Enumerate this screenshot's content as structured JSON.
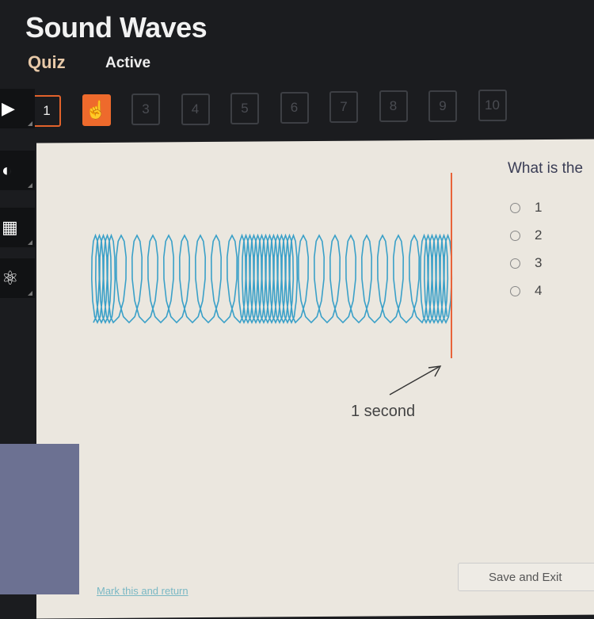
{
  "header": {
    "title": "Sound Waves",
    "tabs": [
      {
        "label": "Quiz"
      },
      {
        "label": "Active"
      }
    ]
  },
  "questions": {
    "items": [
      "1",
      "2",
      "3",
      "4",
      "5",
      "6",
      "7",
      "8",
      "9",
      "10"
    ],
    "current": 1,
    "hovered": 2
  },
  "sidebar": {
    "icons": [
      "arrow-right-icon",
      "headphones-icon",
      "calculator-icon",
      "atom-icon"
    ]
  },
  "question": {
    "text": "What is the",
    "options": [
      "1",
      "2",
      "3",
      "4"
    ],
    "selected": null
  },
  "figure": {
    "label": "1 second",
    "wave_color": "#3aa0c8",
    "marker_color": "#e8643a"
  },
  "footer": {
    "save_label": "Save and Exit",
    "mark_label": "Mark this and return"
  },
  "colors": {
    "accent": "#ee6a2c"
  }
}
